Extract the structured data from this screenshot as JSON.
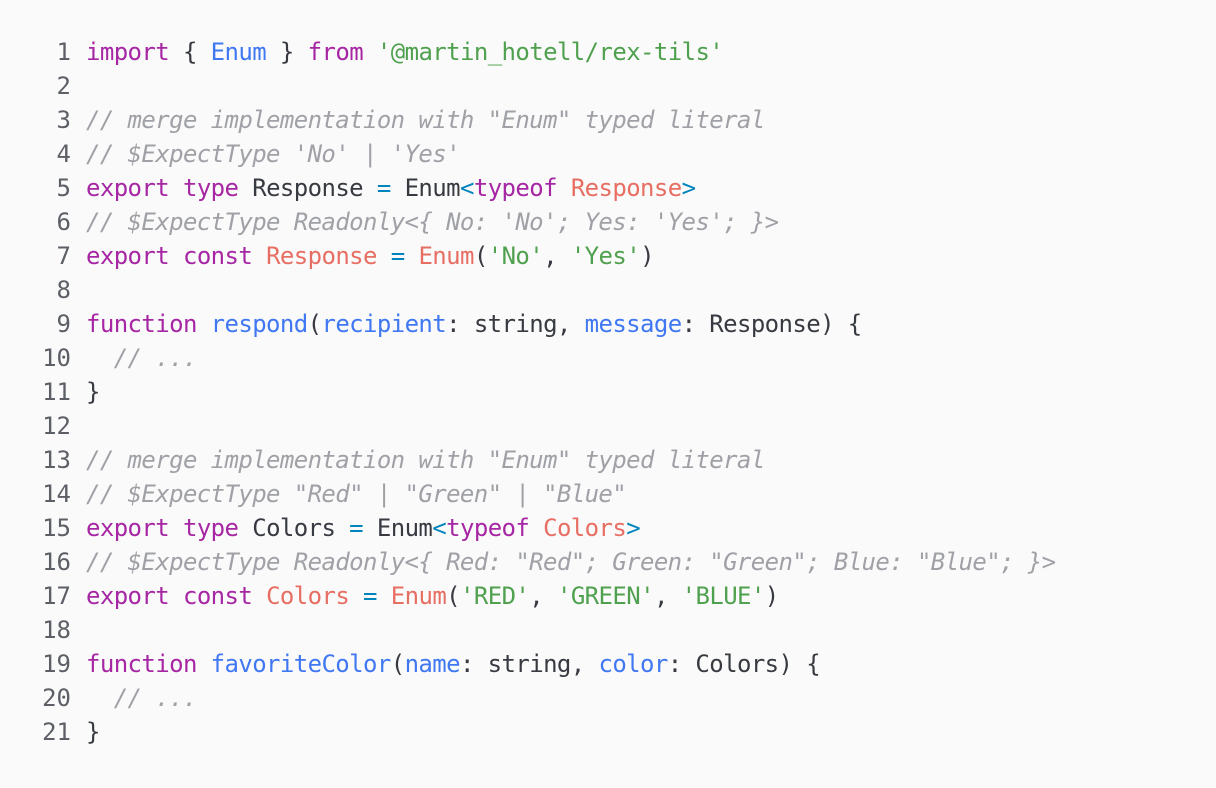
{
  "colors": {
    "background": "#fafafa",
    "keyword": "#a626a4",
    "function": "#4078f2",
    "string": "#50a14f",
    "comment": "#a0a1a7",
    "class": "#e45649",
    "operator": "#0184bc",
    "plain": "#383a42",
    "line_number": "#5c5f66"
  },
  "lines": [
    {
      "n": "1",
      "tokens": [
        {
          "t": "import",
          "c": "keyword"
        },
        {
          "t": " { ",
          "c": "plain"
        },
        {
          "t": "Enum",
          "c": "function"
        },
        {
          "t": " } ",
          "c": "plain"
        },
        {
          "t": "from",
          "c": "keyword"
        },
        {
          "t": " ",
          "c": "plain"
        },
        {
          "t": "'@martin_hotell/rex-tils'",
          "c": "string"
        }
      ]
    },
    {
      "n": "2",
      "tokens": []
    },
    {
      "n": "3",
      "tokens": [
        {
          "t": "// merge implementation with \"Enum\" typed literal",
          "c": "comment"
        }
      ]
    },
    {
      "n": "4",
      "tokens": [
        {
          "t": "// $ExpectType 'No' | 'Yes'",
          "c": "comment"
        }
      ]
    },
    {
      "n": "5",
      "tokens": [
        {
          "t": "export",
          "c": "keyword"
        },
        {
          "t": " ",
          "c": "plain"
        },
        {
          "t": "type",
          "c": "keyword"
        },
        {
          "t": " Response ",
          "c": "plain"
        },
        {
          "t": "=",
          "c": "operator"
        },
        {
          "t": " Enum",
          "c": "plain"
        },
        {
          "t": "<",
          "c": "operator"
        },
        {
          "t": "typeof",
          "c": "keyword"
        },
        {
          "t": " ",
          "c": "plain"
        },
        {
          "t": "Response",
          "c": "class"
        },
        {
          "t": ">",
          "c": "operator"
        }
      ]
    },
    {
      "n": "6",
      "tokens": [
        {
          "t": "// $ExpectType Readonly<{ No: 'No'; Yes: 'Yes'; }>",
          "c": "comment"
        }
      ]
    },
    {
      "n": "7",
      "tokens": [
        {
          "t": "export",
          "c": "keyword"
        },
        {
          "t": " ",
          "c": "plain"
        },
        {
          "t": "const",
          "c": "keyword"
        },
        {
          "t": " ",
          "c": "plain"
        },
        {
          "t": "Response",
          "c": "class"
        },
        {
          "t": " ",
          "c": "plain"
        },
        {
          "t": "=",
          "c": "operator"
        },
        {
          "t": " ",
          "c": "plain"
        },
        {
          "t": "Enum",
          "c": "class"
        },
        {
          "t": "(",
          "c": "plain"
        },
        {
          "t": "'No'",
          "c": "string"
        },
        {
          "t": ", ",
          "c": "plain"
        },
        {
          "t": "'Yes'",
          "c": "string"
        },
        {
          "t": ")",
          "c": "plain"
        }
      ]
    },
    {
      "n": "8",
      "tokens": []
    },
    {
      "n": "9",
      "tokens": [
        {
          "t": "function",
          "c": "keyword"
        },
        {
          "t": " ",
          "c": "plain"
        },
        {
          "t": "respond",
          "c": "function"
        },
        {
          "t": "(",
          "c": "plain"
        },
        {
          "t": "recipient",
          "c": "param"
        },
        {
          "t": ": string, ",
          "c": "plain"
        },
        {
          "t": "message",
          "c": "param"
        },
        {
          "t": ": Response) {",
          "c": "plain"
        }
      ]
    },
    {
      "n": "10",
      "tokens": [
        {
          "t": "  ",
          "c": "plain"
        },
        {
          "t": "// ...",
          "c": "comment"
        }
      ]
    },
    {
      "n": "11",
      "tokens": [
        {
          "t": "}",
          "c": "plain"
        }
      ]
    },
    {
      "n": "12",
      "tokens": []
    },
    {
      "n": "13",
      "tokens": [
        {
          "t": "// merge implementation with \"Enum\" typed literal",
          "c": "comment"
        }
      ]
    },
    {
      "n": "14",
      "tokens": [
        {
          "t": "// $ExpectType \"Red\" | \"Green\" | \"Blue\"",
          "c": "comment"
        }
      ]
    },
    {
      "n": "15",
      "tokens": [
        {
          "t": "export",
          "c": "keyword"
        },
        {
          "t": " ",
          "c": "plain"
        },
        {
          "t": "type",
          "c": "keyword"
        },
        {
          "t": " Colors ",
          "c": "plain"
        },
        {
          "t": "=",
          "c": "operator"
        },
        {
          "t": " Enum",
          "c": "plain"
        },
        {
          "t": "<",
          "c": "operator"
        },
        {
          "t": "typeof",
          "c": "keyword"
        },
        {
          "t": " ",
          "c": "plain"
        },
        {
          "t": "Colors",
          "c": "class"
        },
        {
          "t": ">",
          "c": "operator"
        }
      ]
    },
    {
      "n": "16",
      "tokens": [
        {
          "t": "// $ExpectType Readonly<{ Red: \"Red\"; Green: \"Green\"; Blue: \"Blue\"; }>",
          "c": "comment"
        }
      ]
    },
    {
      "n": "17",
      "tokens": [
        {
          "t": "export",
          "c": "keyword"
        },
        {
          "t": " ",
          "c": "plain"
        },
        {
          "t": "const",
          "c": "keyword"
        },
        {
          "t": " ",
          "c": "plain"
        },
        {
          "t": "Colors",
          "c": "class"
        },
        {
          "t": " ",
          "c": "plain"
        },
        {
          "t": "=",
          "c": "operator"
        },
        {
          "t": " ",
          "c": "plain"
        },
        {
          "t": "Enum",
          "c": "class"
        },
        {
          "t": "(",
          "c": "plain"
        },
        {
          "t": "'RED'",
          "c": "string"
        },
        {
          "t": ", ",
          "c": "plain"
        },
        {
          "t": "'GREEN'",
          "c": "string"
        },
        {
          "t": ", ",
          "c": "plain"
        },
        {
          "t": "'BLUE'",
          "c": "string"
        },
        {
          "t": ")",
          "c": "plain"
        }
      ]
    },
    {
      "n": "18",
      "tokens": []
    },
    {
      "n": "19",
      "tokens": [
        {
          "t": "function",
          "c": "keyword"
        },
        {
          "t": " ",
          "c": "plain"
        },
        {
          "t": "favoriteColor",
          "c": "function"
        },
        {
          "t": "(",
          "c": "plain"
        },
        {
          "t": "name",
          "c": "param"
        },
        {
          "t": ": string, ",
          "c": "plain"
        },
        {
          "t": "color",
          "c": "param"
        },
        {
          "t": ": Colors) {",
          "c": "plain"
        }
      ]
    },
    {
      "n": "20",
      "tokens": [
        {
          "t": "  ",
          "c": "plain"
        },
        {
          "t": "// ...",
          "c": "comment"
        }
      ]
    },
    {
      "n": "21",
      "tokens": [
        {
          "t": "}",
          "c": "plain"
        }
      ]
    }
  ]
}
